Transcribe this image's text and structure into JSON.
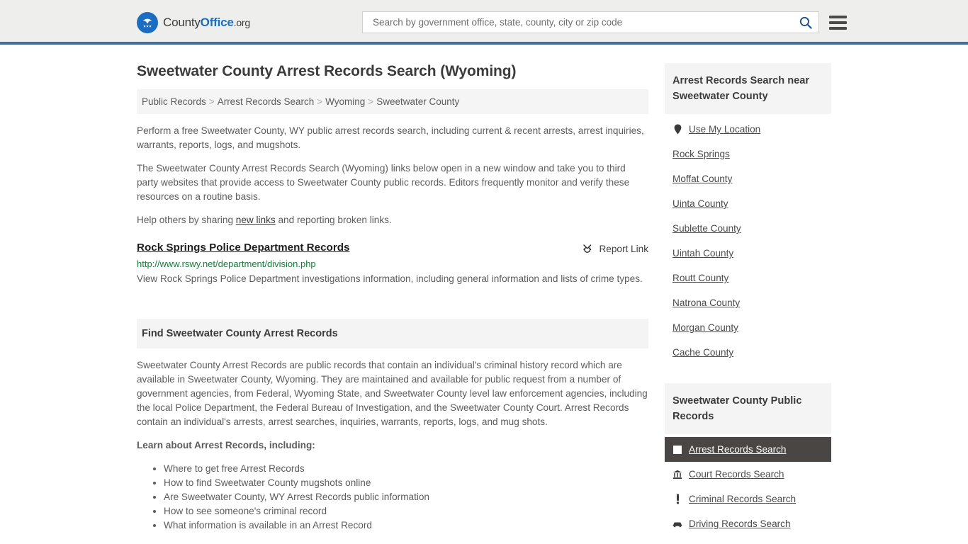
{
  "header": {
    "brand": {
      "part1": "County",
      "part2": "Office",
      "part3": ".org",
      "logo_icon": "eagle-shield-logo"
    },
    "search": {
      "placeholder": "Search by government office, state, county, city or zip code",
      "value": "",
      "icon": "search-icon"
    },
    "menu_icon": "hamburger-menu-icon",
    "accent_color": "#3d6e9e"
  },
  "page": {
    "title": "Sweetwater County Arrest Records Search (Wyoming)"
  },
  "breadcrumb": {
    "separator": ">",
    "items": [
      {
        "label": "Public Records"
      },
      {
        "label": "Arrest Records Search"
      },
      {
        "label": "Wyoming"
      },
      {
        "label": "Sweetwater County"
      }
    ]
  },
  "intro": {
    "p1": "Perform a free Sweetwater County, WY public arrest records search, including current & recent arrests, arrest inquiries, warrants, reports, logs, and mugshots.",
    "p2": "The Sweetwater County Arrest Records Search (Wyoming) links below open in a new window and take you to third party websites that provide access to Sweetwater County public records. Editors frequently monitor and verify these resources on a routine basis.",
    "p3_before": "Help others by sharing ",
    "p3_link": "new links",
    "p3_after": " and reporting broken links."
  },
  "result": {
    "title": "Rock Springs Police Department Records",
    "url": "http://www.rswy.net/department/division.php",
    "description": "View Rock Springs Police Department investigations information, including general information and lists of crime types.",
    "report_label": "Report Link",
    "report_icon": "broken-link-icon",
    "url_color": "#1a7a3c"
  },
  "find_section": {
    "heading": "Find Sweetwater County Arrest Records",
    "paragraph": "Sweetwater County Arrest Records are public records that contain an individual's criminal history record which are available in Sweetwater County, Wyoming. They are maintained and available for public request from a number of government agencies, from Federal, Wyoming State, and Sweetwater County level law enforcement agencies, including the local Police Department, the Federal Bureau of Investigation, and the Sweetwater County Court. Arrest Records contain an individual's arrests, arrest searches, inquiries, warrants, reports, logs, and mug shots.",
    "learn_title": "Learn about Arrest Records, including:",
    "bullets": [
      "Where to get free Arrest Records",
      "How to find Sweetwater County mugshots online",
      "Are Sweetwater County, WY Arrest Records public information",
      "How to see someone's criminal record",
      "What information is available in an Arrest Record"
    ]
  },
  "sidebar": {
    "nearby": {
      "heading": "Arrest Records Search near Sweetwater County",
      "items": [
        {
          "label": "Use My Location",
          "icon": "map-pin-icon"
        },
        {
          "label": "Rock Springs",
          "icon": ""
        },
        {
          "label": "Moffat County",
          "icon": ""
        },
        {
          "label": "Uinta County",
          "icon": ""
        },
        {
          "label": "Sublette County",
          "icon": ""
        },
        {
          "label": "Uintah County",
          "icon": ""
        },
        {
          "label": "Routt County",
          "icon": ""
        },
        {
          "label": "Natrona County",
          "icon": ""
        },
        {
          "label": "Morgan County",
          "icon": ""
        },
        {
          "label": "Cache County",
          "icon": ""
        }
      ]
    },
    "public_records": {
      "heading": "Sweetwater County Public Records",
      "active_color": "#4a4643",
      "items": [
        {
          "label": "Arrest Records Search",
          "icon": "square-icon",
          "active": true
        },
        {
          "label": "Court Records Search",
          "icon": "courthouse-icon",
          "active": false
        },
        {
          "label": "Criminal Records Search",
          "icon": "exclamation-icon",
          "active": false
        },
        {
          "label": "Driving Records Search",
          "icon": "car-icon",
          "active": false
        }
      ]
    }
  }
}
